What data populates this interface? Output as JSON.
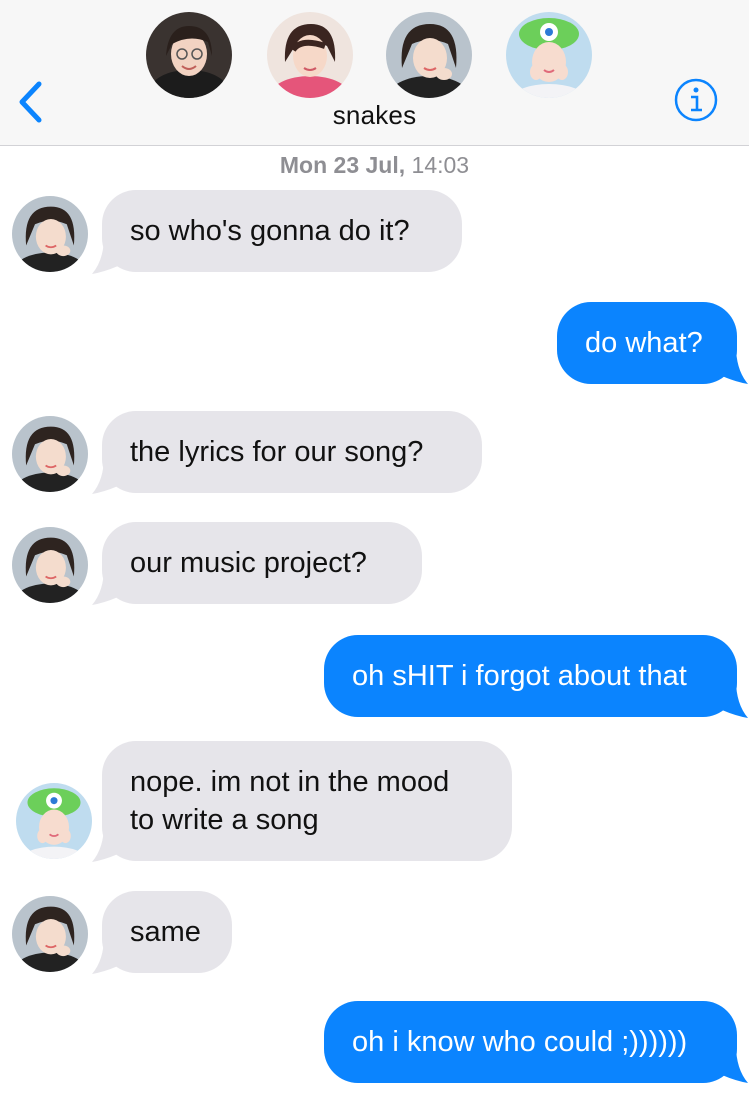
{
  "header": {
    "title": "snakes",
    "back_icon": "chevron-left-icon",
    "info_icon": "info-circle-icon",
    "participants": [
      "participant-1",
      "participant-2",
      "participant-3",
      "participant-4"
    ]
  },
  "thread": {
    "timestamp_day": "Mon 23 Jul,",
    "timestamp_time": "14:03"
  },
  "messages": [
    {
      "direction": "in",
      "sender": "participant-3",
      "text": "so who's gonna do it?"
    },
    {
      "direction": "out",
      "text": "do what?"
    },
    {
      "direction": "in",
      "sender": "participant-3",
      "text": "the lyrics for our song?"
    },
    {
      "direction": "in",
      "sender": "participant-3",
      "text": "our music project?"
    },
    {
      "direction": "out",
      "text": "oh sHIT i forgot about that"
    },
    {
      "direction": "in",
      "sender": "participant-4",
      "text": "nope. im not in the mood\nto write a song"
    },
    {
      "direction": "in",
      "sender": "participant-3",
      "text": "same"
    },
    {
      "direction": "out",
      "text": "oh i know who could ;))))))"
    }
  ],
  "colors": {
    "accent": "#0b84fe",
    "incoming_bubble": "#e6e5ea",
    "header_bg": "#f7f7f7",
    "timestamp": "#8e8e93"
  }
}
